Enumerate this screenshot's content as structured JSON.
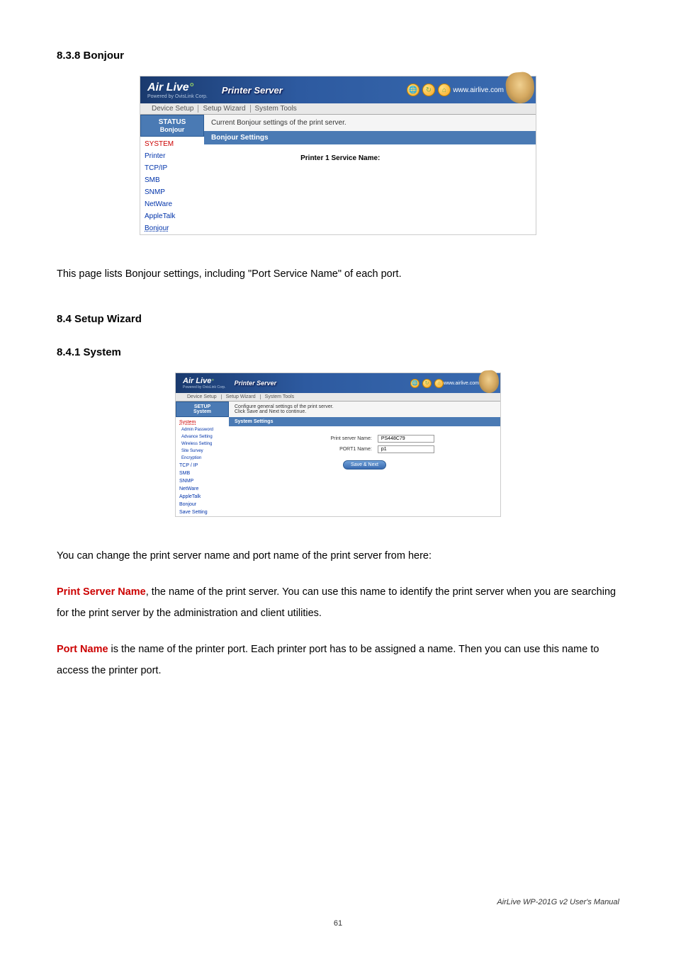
{
  "headings": {
    "h838": "8.3.8 Bonjour",
    "h84": "8.4 Setup Wizard",
    "h841": "8.4.1 System"
  },
  "screenshot1": {
    "logo": "Air Live",
    "logo_sub": "Powered by OvisLink Corp.",
    "product": "Printer Server",
    "url": "www.airlive.com",
    "tabs": [
      "Device Setup",
      "Setup Wizard",
      "System Tools"
    ],
    "sidebar_box_line1": "STATUS",
    "sidebar_box_line2": "Bonjour",
    "sidebar_items": [
      "SYSTEM",
      "Printer",
      "TCP/IP",
      "SMB",
      "SNMP",
      "NetWare",
      "AppleTalk",
      "Bonjour"
    ],
    "desc": "Current Bonjour settings of the print server.",
    "section_bar": "Bonjour Settings",
    "form_label": "Printer 1 Service Name:"
  },
  "screenshot2": {
    "logo": "Air Live",
    "logo_sub": "Powered by OvisLink Corp.",
    "product": "Printer Server",
    "url": "www.airlive.com",
    "tabs": [
      "Device Setup",
      "Setup Wizard",
      "System Tools"
    ],
    "sidebar_box_line1": "SETUP",
    "sidebar_box_line2": "System",
    "sidebar_item_system": "System",
    "sidebar_sub_items": [
      "Admin Password",
      "Advance Setting",
      "Wireless Setting",
      "Site Survey",
      "Encryption"
    ],
    "sidebar_items_rest": [
      "TCP / IP",
      "SMB",
      "SNMP",
      "NetWare",
      "AppleTalk",
      "Bonjour",
      "Save Setting"
    ],
    "desc_line1": "Configure general settings of the print server.",
    "desc_line2": "Click Save and Next to continue.",
    "section_bar": "System Settings",
    "form_label1": "Print server Name:",
    "form_value1": "PS448C79",
    "form_label2": "PORT1 Name:",
    "form_value2": "p1",
    "button": "Save & Next"
  },
  "paragraphs": {
    "p1": "This page lists Bonjour settings, including \"Port Service Name\" of each port.",
    "p2": "You can change the print server name and port name of the print server from here:",
    "p3a": "Print Server Name",
    "p3b": ", the name of the print server. You can use this name to identify the print server when you are searching for the print server by the administration and client utilities.",
    "p4a": "Port Name",
    "p4b": " is the name of the printer port. Each printer port has to be assigned a name. Then you can use this name to access the printer port."
  },
  "footer": {
    "right": "AirLive WP-201G v2 User's Manual",
    "page": "61"
  }
}
